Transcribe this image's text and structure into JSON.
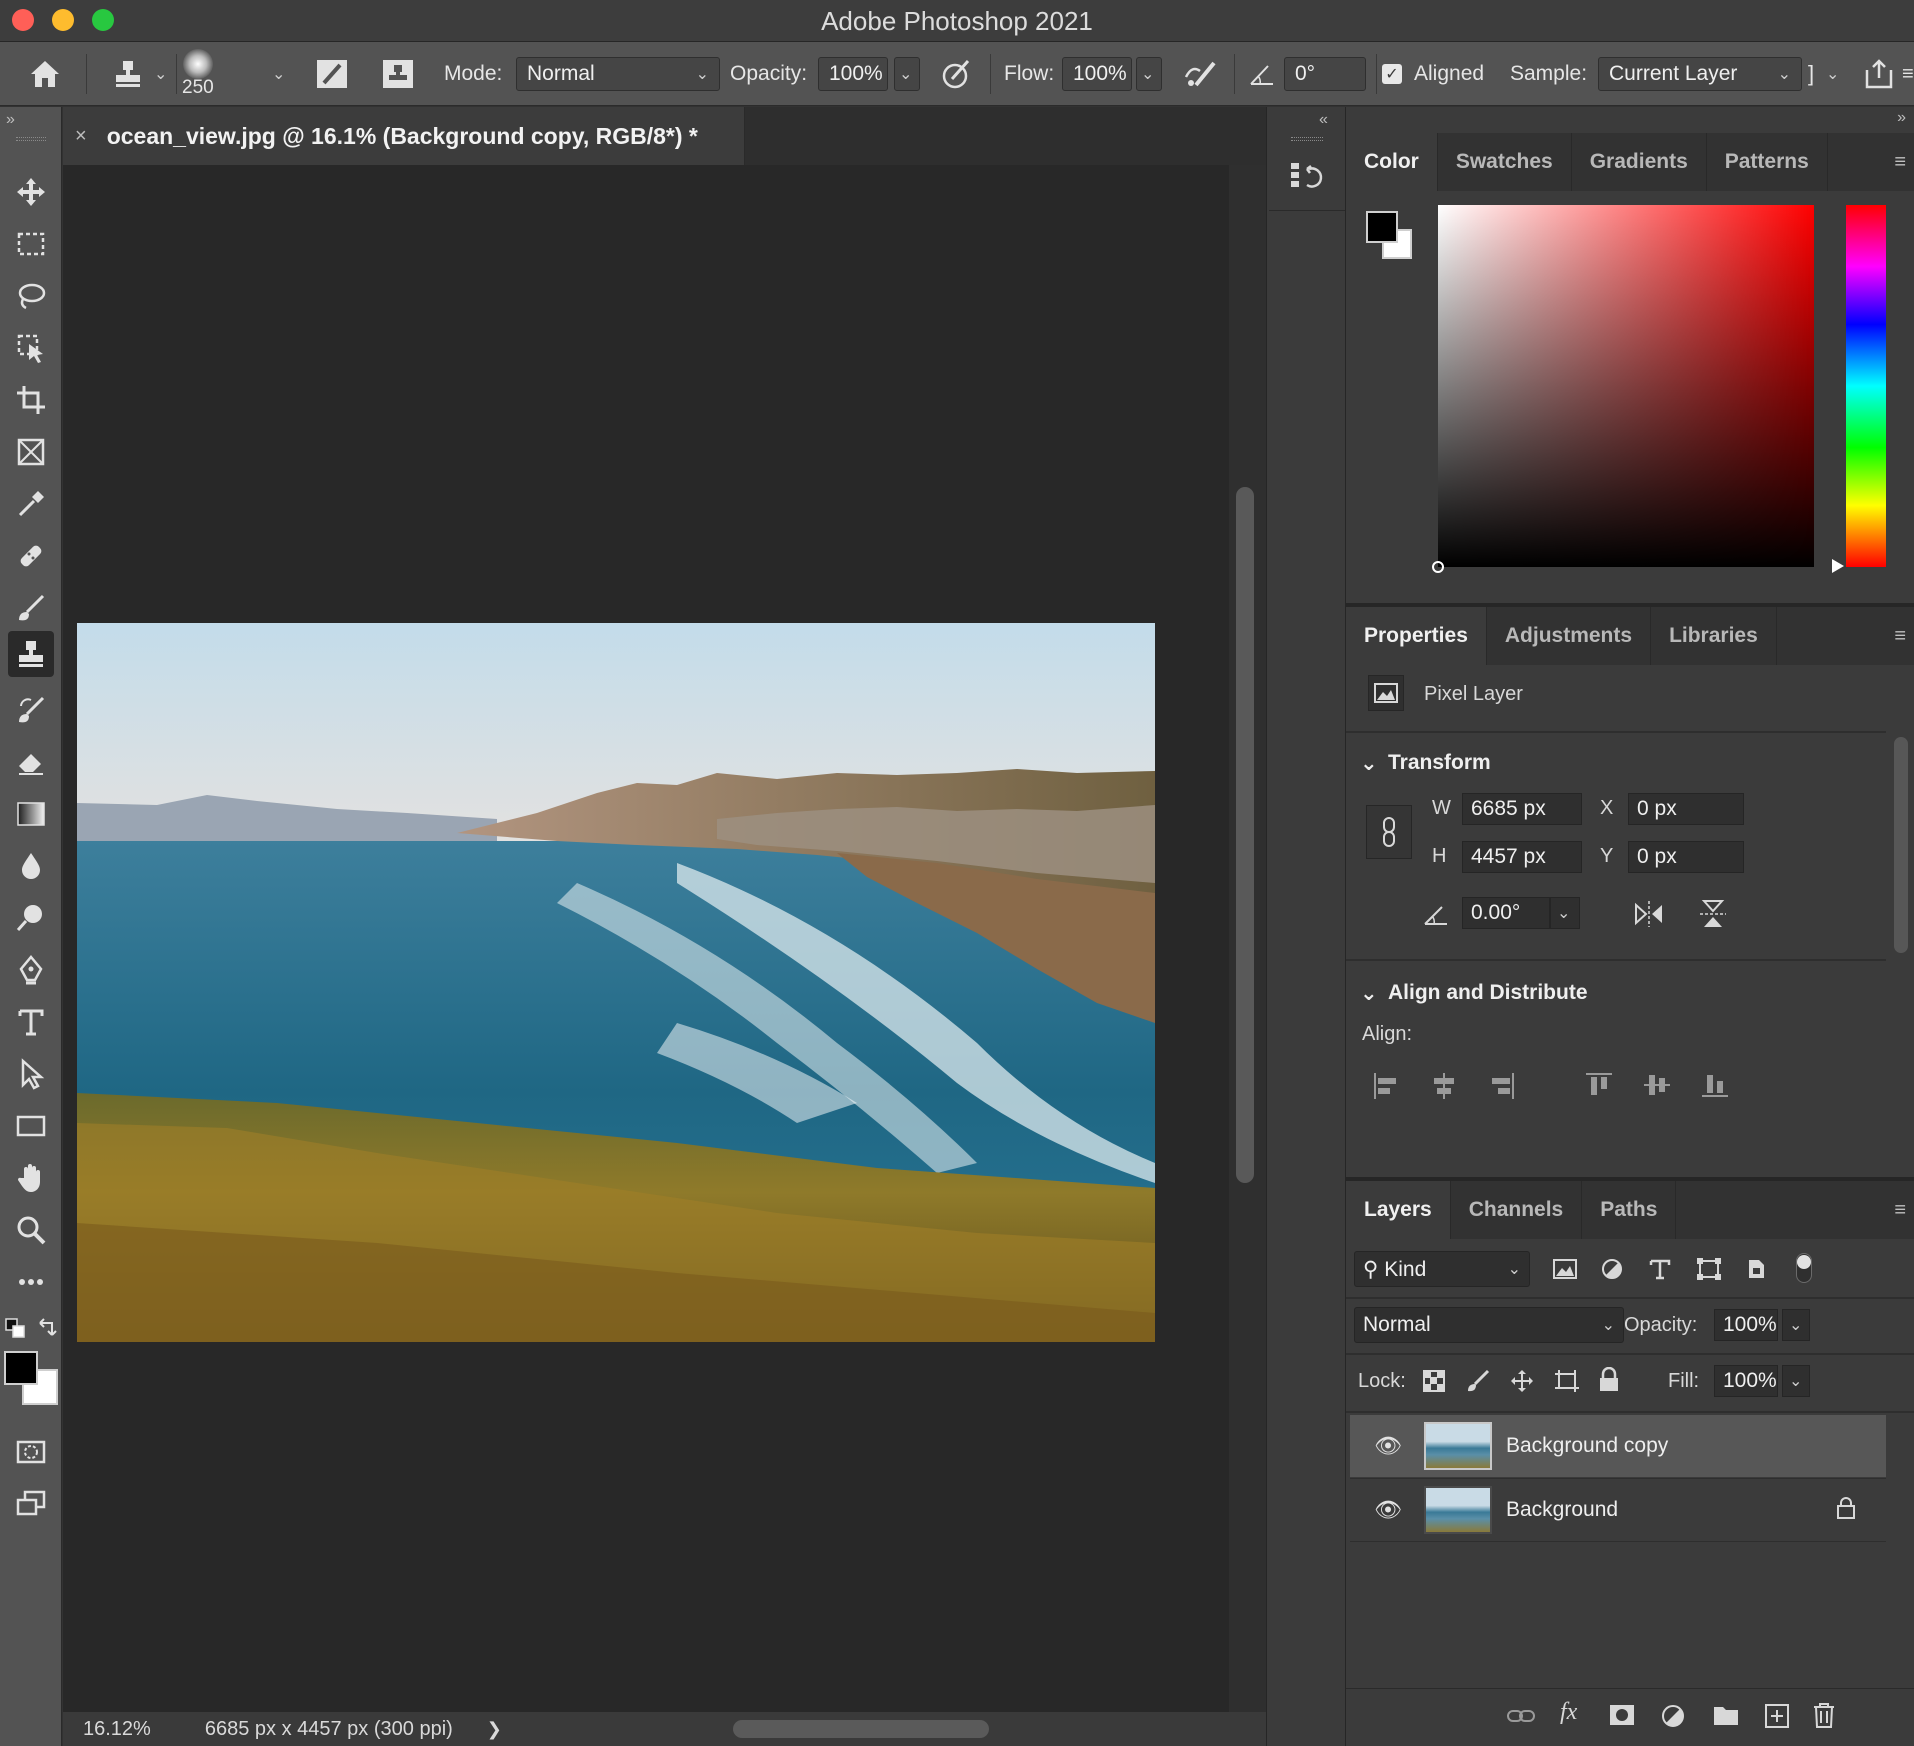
{
  "window": {
    "title": "Adobe Photoshop 2021"
  },
  "options_bar": {
    "brush_size": "250",
    "mode_label": "Mode:",
    "mode_value": "Normal",
    "opacity_label": "Opacity:",
    "opacity_value": "100%",
    "flow_label": "Flow:",
    "flow_value": "100%",
    "angle_value": "0°",
    "aligned_label": "Aligned",
    "aligned_checked": true,
    "sample_label": "Sample:",
    "sample_value": "Current Layer"
  },
  "document": {
    "tab_title": "ocean_view.jpg @ 16.1% (Background copy, RGB/8*) *",
    "zoom": "16.12%",
    "dimensions": "6685 px x 4457 px (300 ppi)"
  },
  "color_panel": {
    "tabs": [
      "Color",
      "Swatches",
      "Gradients",
      "Patterns"
    ],
    "foreground": "#000000",
    "background": "#ffffff",
    "hue_color": "#ff0000"
  },
  "properties_panel": {
    "tabs": [
      "Properties",
      "Adjustments",
      "Libraries"
    ],
    "layer_type": "Pixel Layer",
    "transform": {
      "title": "Transform",
      "w_label": "W",
      "w_value": "6685 px",
      "h_label": "H",
      "h_value": "4457 px",
      "x_label": "X",
      "x_value": "0 px",
      "y_label": "Y",
      "y_value": "0 px",
      "angle_value": "0.00°"
    },
    "align": {
      "title": "Align and Distribute",
      "label": "Align:"
    }
  },
  "layers_panel": {
    "tabs": [
      "Layers",
      "Channels",
      "Paths"
    ],
    "filter_label": "Kind",
    "blend_mode": "Normal",
    "opacity_label": "Opacity:",
    "opacity_value": "100%",
    "lock_label": "Lock:",
    "fill_label": "Fill:",
    "fill_value": "100%",
    "layers": [
      {
        "name": "Background copy",
        "selected": true,
        "locked": false
      },
      {
        "name": "Background",
        "selected": false,
        "locked": true
      }
    ]
  }
}
